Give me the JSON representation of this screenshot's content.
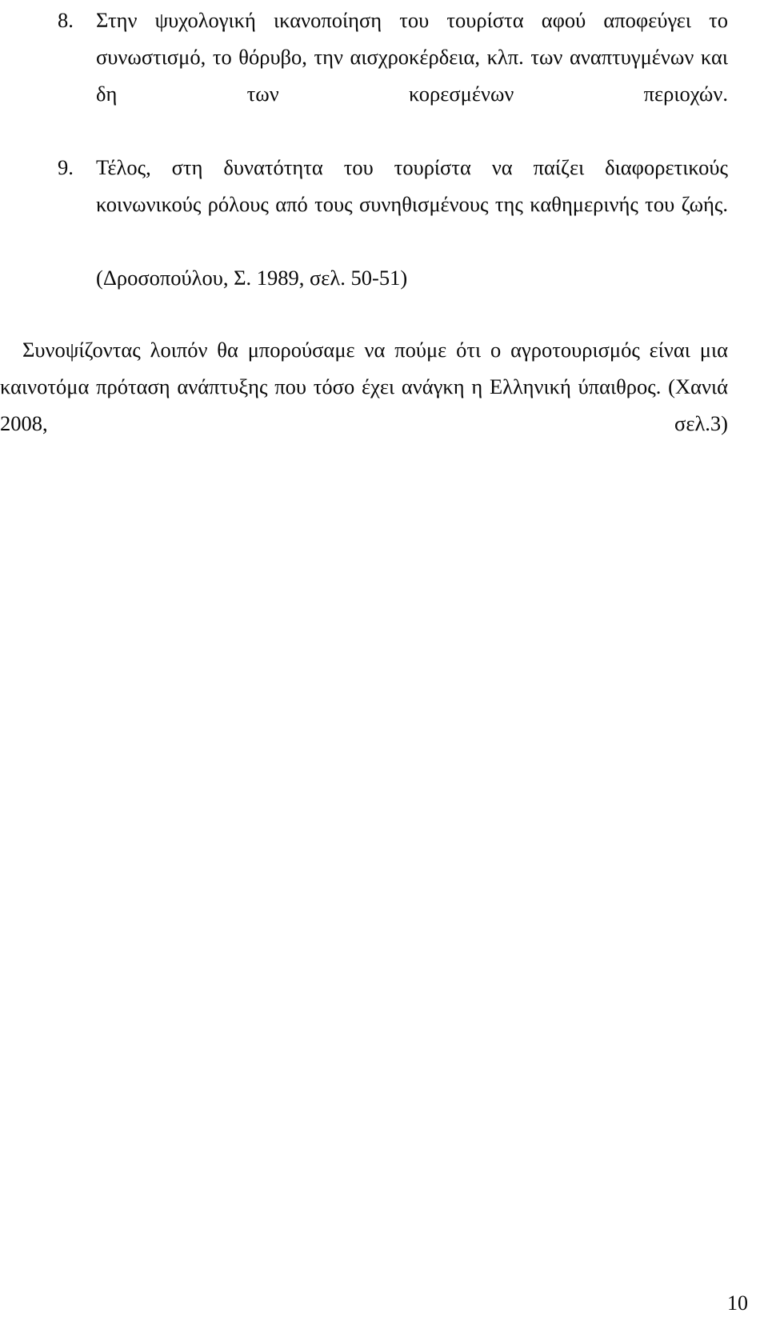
{
  "document": {
    "language": "el",
    "page_number": "10",
    "text_color": "#0a0a0a",
    "background_color": "#ffffff"
  },
  "list": {
    "items": [
      {
        "marker": "8.",
        "text": "Στην ψυχολογική ικανοποίηση του τουρίστα αφού αποφεύγει το συνωστισμό, το θόρυβο, την αισχροκέρδεια, κλπ. των αναπτυγμένων και δη των κορεσμένων περιοχών."
      },
      {
        "marker": "9.",
        "text": "Τέλος, στη δυνατότητα του τουρίστα να παίζει διαφορετικούς κοινωνικούς ρόλους από τους συνηθισμένους της καθημερινής του ζωής."
      }
    ],
    "citation": "(Δροσοπούλου, Σ. 1989, σελ. 50-51)"
  },
  "closing_paragraph": {
    "text": "Συνοψίζοντας λοιπόν θα μπορούσαμε να πούμε ότι ο αγροτουρισμός είναι μια καινοτόμα πρόταση ανάπτυξης που τόσο έχει ανάγκη η Ελληνική ύπαιθρος. (Χανιά 2008, σελ.3)"
  }
}
